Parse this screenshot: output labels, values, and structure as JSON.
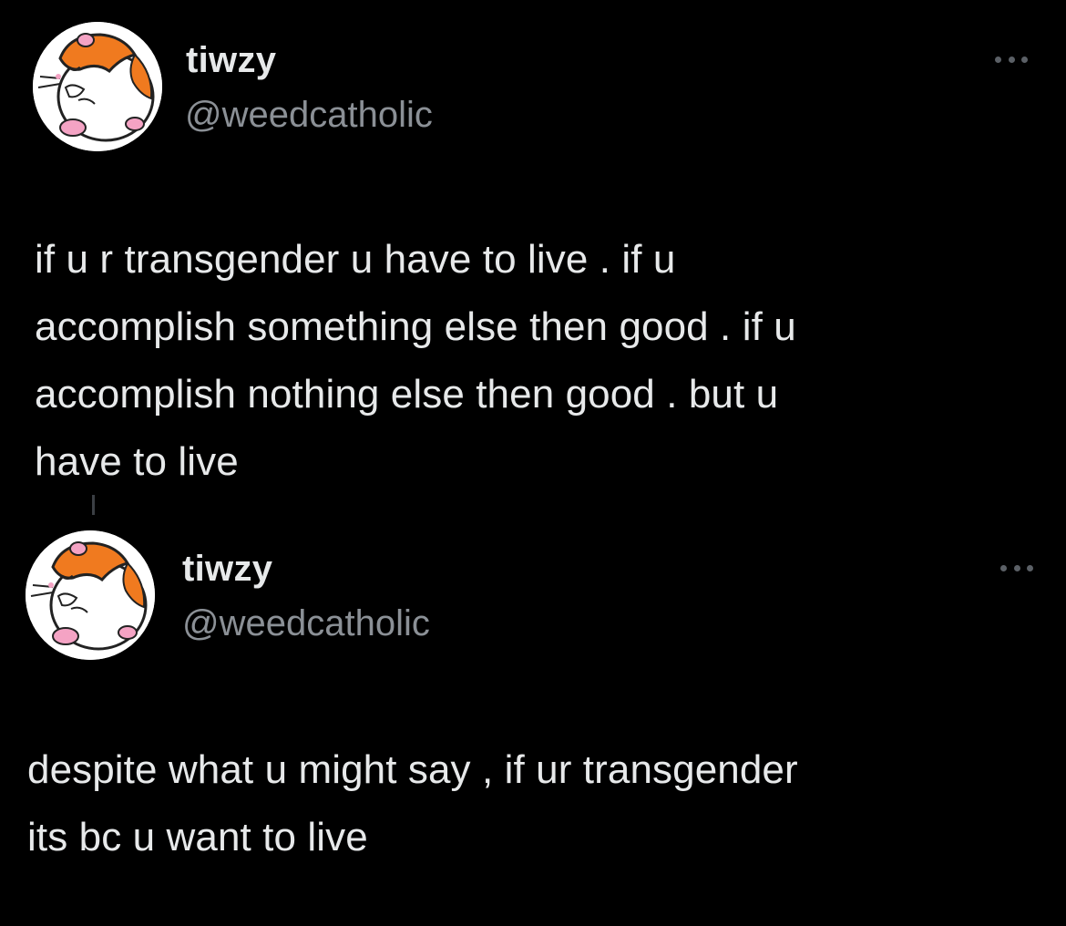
{
  "tweets": [
    {
      "author": {
        "display_name": "tiwzy",
        "handle": "@weedcatholic",
        "avatar_icon": "hamster-avatar-icon"
      },
      "more_icon": "more-dots-icon",
      "text": "if u r transgender u have to live . if u\naccomplish something else then good .  if u\naccomplish nothing else then good . but u\nhave to live"
    },
    {
      "author": {
        "display_name": "tiwzy",
        "handle": "@weedcatholic",
        "avatar_icon": "hamster-avatar-icon"
      },
      "more_icon": "more-dots-icon",
      "text": "despite what u might say , if ur transgender\nits bc u want to live"
    }
  ],
  "colors": {
    "background": "#000000",
    "primary_text": "#e7e9ea",
    "secondary_text": "#8b9096",
    "hamster_orange": "#f07a1f",
    "hamster_pink": "#f4a3c4"
  }
}
